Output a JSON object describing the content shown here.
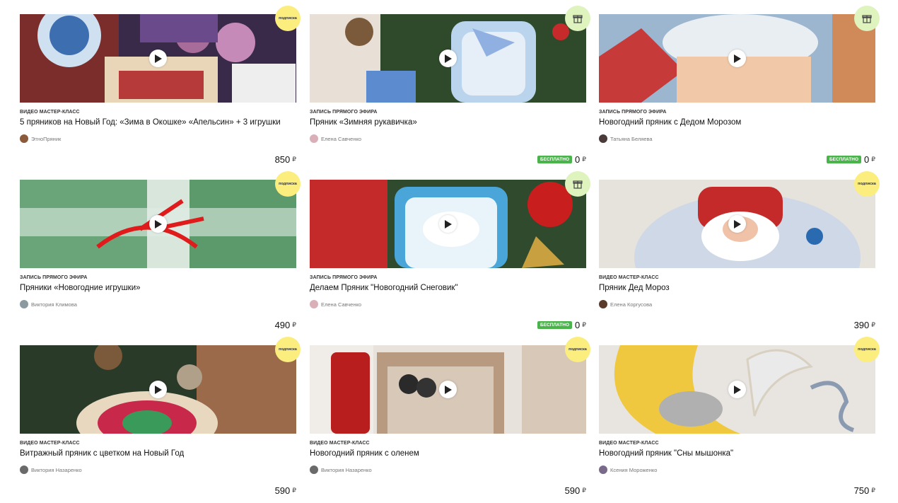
{
  "currency": "₽",
  "cards": [
    {
      "type": "Видео мастер-класс",
      "title": "5 пряников на Новый Год: «Зима в Окошке» «Апельсин» + 3 игрушки",
      "author": "ЭтноПряник",
      "price": "850",
      "free_label": "",
      "badge": "подписка",
      "badge_kind": "sub"
    },
    {
      "type": "Запись прямого эфира",
      "title": "Пряник «Зимняя рукавичка»",
      "author": "Елена Савченко",
      "price": "0",
      "free_label": "Бесплатно",
      "badge": "",
      "badge_kind": "gift"
    },
    {
      "type": "Запись прямого эфира",
      "title": "Новогодний пряник с Дедом Морозом",
      "author": "Татьяна Беляева",
      "price": "0",
      "free_label": "Бесплатно",
      "badge": "",
      "badge_kind": "gift"
    },
    {
      "type": "Запись прямого эфира",
      "title": "Пряники «Новогодние игрушки»",
      "author": "Виктория Климова",
      "price": "490",
      "free_label": "",
      "badge": "подписка",
      "badge_kind": "sub"
    },
    {
      "type": "Запись прямого эфира",
      "title": "Делаем Пряник \"Новогодний Снеговик\"",
      "author": "Елена Савченко",
      "price": "0",
      "free_label": "Бесплатно",
      "badge": "",
      "badge_kind": "gift"
    },
    {
      "type": "Видео мастер-класс",
      "title": "Пряник Дед Мороз",
      "author": "Елена Коргусова",
      "price": "390",
      "free_label": "",
      "badge": "подписка",
      "badge_kind": "sub"
    },
    {
      "type": "Видео мастер-класс",
      "title": "Витражный пряник с цветком на Новый Год",
      "author": "Виктория Назаренко",
      "price": "590",
      "free_label": "",
      "badge": "подписка",
      "badge_kind": "sub"
    },
    {
      "type": "Видео мастер-класс",
      "title": "Новогодний пряник с оленем",
      "author": "Виктория Назаренко",
      "price": "590",
      "free_label": "",
      "badge": "подписка",
      "badge_kind": "sub"
    },
    {
      "type": "Видео мастер-класс",
      "title": "Новогодний пряник \"Сны мышонка\"",
      "author": "Ксения Мороженко",
      "price": "750",
      "free_label": "",
      "badge": "подписка",
      "badge_kind": "sub"
    }
  ],
  "colors": {
    "subscription_badge": "#fbee7e",
    "gift_badge": "#def3bd",
    "free_badge": "#4bb34b"
  },
  "icons": {
    "play": "play-icon",
    "gift": "gift-icon"
  }
}
